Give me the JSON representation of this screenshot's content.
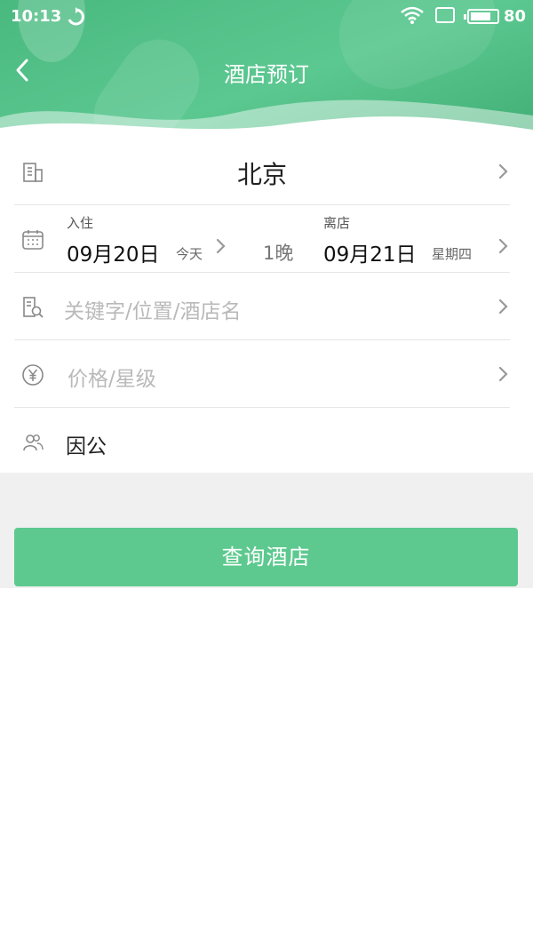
{
  "status_bar": {
    "time": "10:13",
    "battery": "80"
  },
  "nav": {
    "title": "酒店预订"
  },
  "form": {
    "city": "北京",
    "checkin": {
      "label": "入住",
      "date": "09月20日",
      "day": "今天"
    },
    "nights": "1晚",
    "checkout": {
      "label": "离店",
      "date": "09月21日",
      "day": "星期四"
    },
    "keyword_placeholder": "关键字/位置/酒店名",
    "price_placeholder": "价格/星级",
    "travel_type": "因公"
  },
  "search_button": "查询酒店",
  "colors": {
    "accent": "#5dc98f",
    "header": "#4cbb81"
  }
}
